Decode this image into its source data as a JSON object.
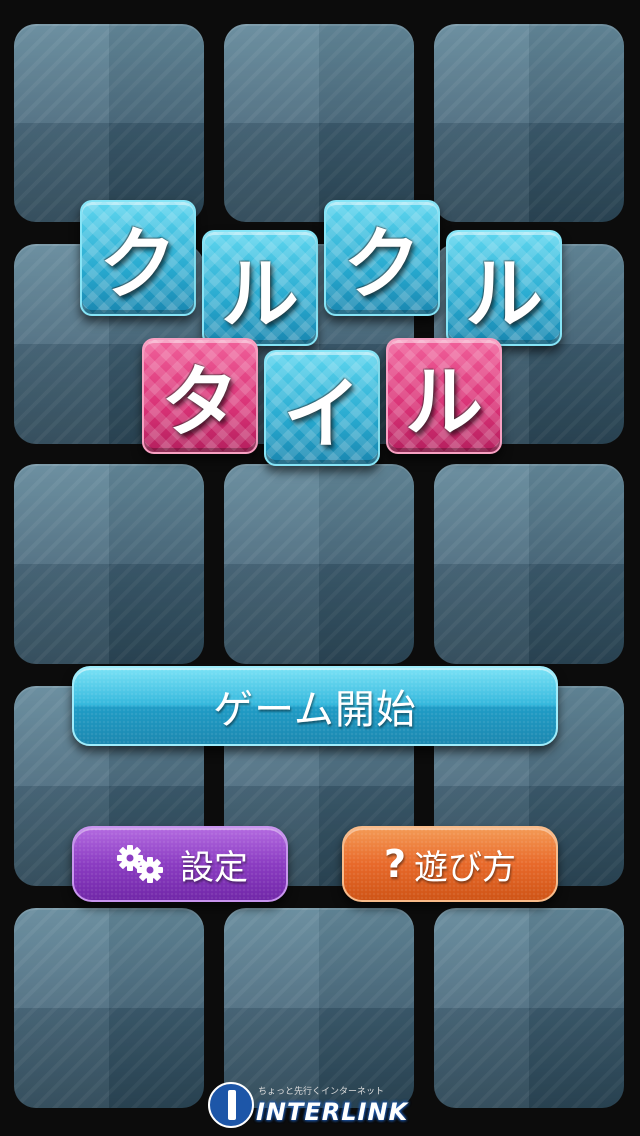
{
  "title": {
    "row1": [
      "ク",
      "ル",
      "ク",
      "ル"
    ],
    "row2": [
      "タ",
      "イ",
      "ル"
    ],
    "colors": {
      "blue": "#27a9cf",
      "pink": "#d93276"
    }
  },
  "menu": {
    "start_label": "ゲーム開始",
    "settings_label": "設定",
    "howto_label": "遊び方",
    "howto_icon_glyph": "?",
    "settings_icon": "gears-icon",
    "howto_icon": "question-icon",
    "colors": {
      "start": "#35b8dd",
      "settings": "#8b3cc2",
      "howto": "#e8692a"
    }
  },
  "footer": {
    "tagline": "ちょっと先行くインターネット",
    "brand": "INTERLINK",
    "brand_color": "#1d56a8"
  }
}
